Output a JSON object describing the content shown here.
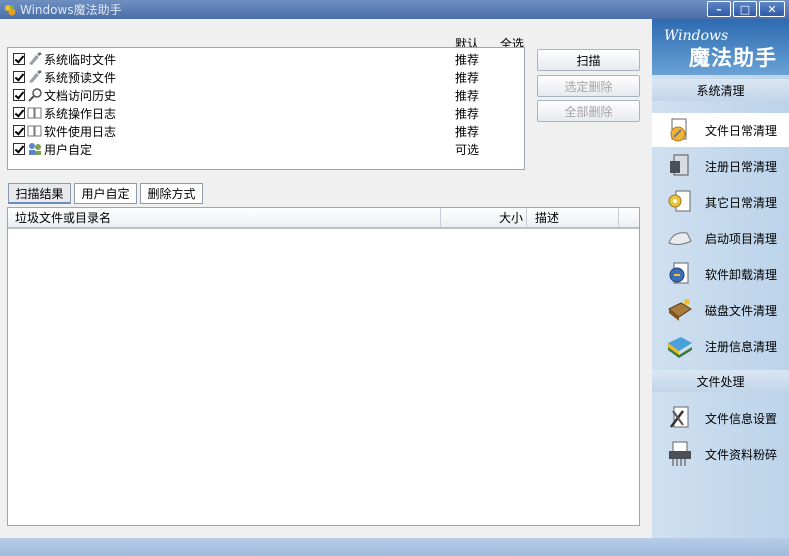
{
  "window": {
    "title": "Windows魔法助手"
  },
  "checklist": {
    "header_default": "默认",
    "header_all": "全选",
    "items": [
      {
        "label": "系统临时文件",
        "rec": "推荐",
        "icon": "broom-icon"
      },
      {
        "label": "系统预读文件",
        "rec": "推荐",
        "icon": "broom-icon"
      },
      {
        "label": "文档访问历史",
        "rec": "推荐",
        "icon": "magnifier-doc-icon"
      },
      {
        "label": "系统操作日志",
        "rec": "推荐",
        "icon": "book-icon"
      },
      {
        "label": "软件使用日志",
        "rec": "推荐",
        "icon": "book-icon"
      },
      {
        "label": "用户自定",
        "rec": "可选",
        "icon": "users-icon"
      }
    ]
  },
  "actions": {
    "scan": "扫描",
    "delete_selected": "选定删除",
    "delete_all": "全部删除"
  },
  "tabs": [
    "扫描结果",
    "用户自定",
    "删除方式"
  ],
  "results": {
    "col_name": "垃圾文件或目录名",
    "col_size": "大小",
    "col_desc": "描述"
  },
  "sidebar": {
    "logo_top": "Windows",
    "logo_main": "魔法助手",
    "section_clean": "系统清理",
    "clean_items": [
      {
        "label": "文件日常清理",
        "icon": "file-clean-icon"
      },
      {
        "label": "注册日常清理",
        "icon": "registry-icon"
      },
      {
        "label": "其它日常清理",
        "icon": "gear-doc-icon"
      },
      {
        "label": "启动项目清理",
        "icon": "startup-icon"
      },
      {
        "label": "软件卸载清理",
        "icon": "uninstall-icon"
      },
      {
        "label": "磁盘文件清理",
        "icon": "disk-icon"
      },
      {
        "label": "注册信息清理",
        "icon": "registry-info-icon"
      }
    ],
    "section_file": "文件处理",
    "file_items": [
      {
        "label": "文件信息设置",
        "icon": "file-settings-icon"
      },
      {
        "label": "文件资料粉碎",
        "icon": "shredder-icon"
      }
    ]
  },
  "colors": {
    "accent": "#4a6ea8",
    "sidebar": "#c2d5ea"
  }
}
